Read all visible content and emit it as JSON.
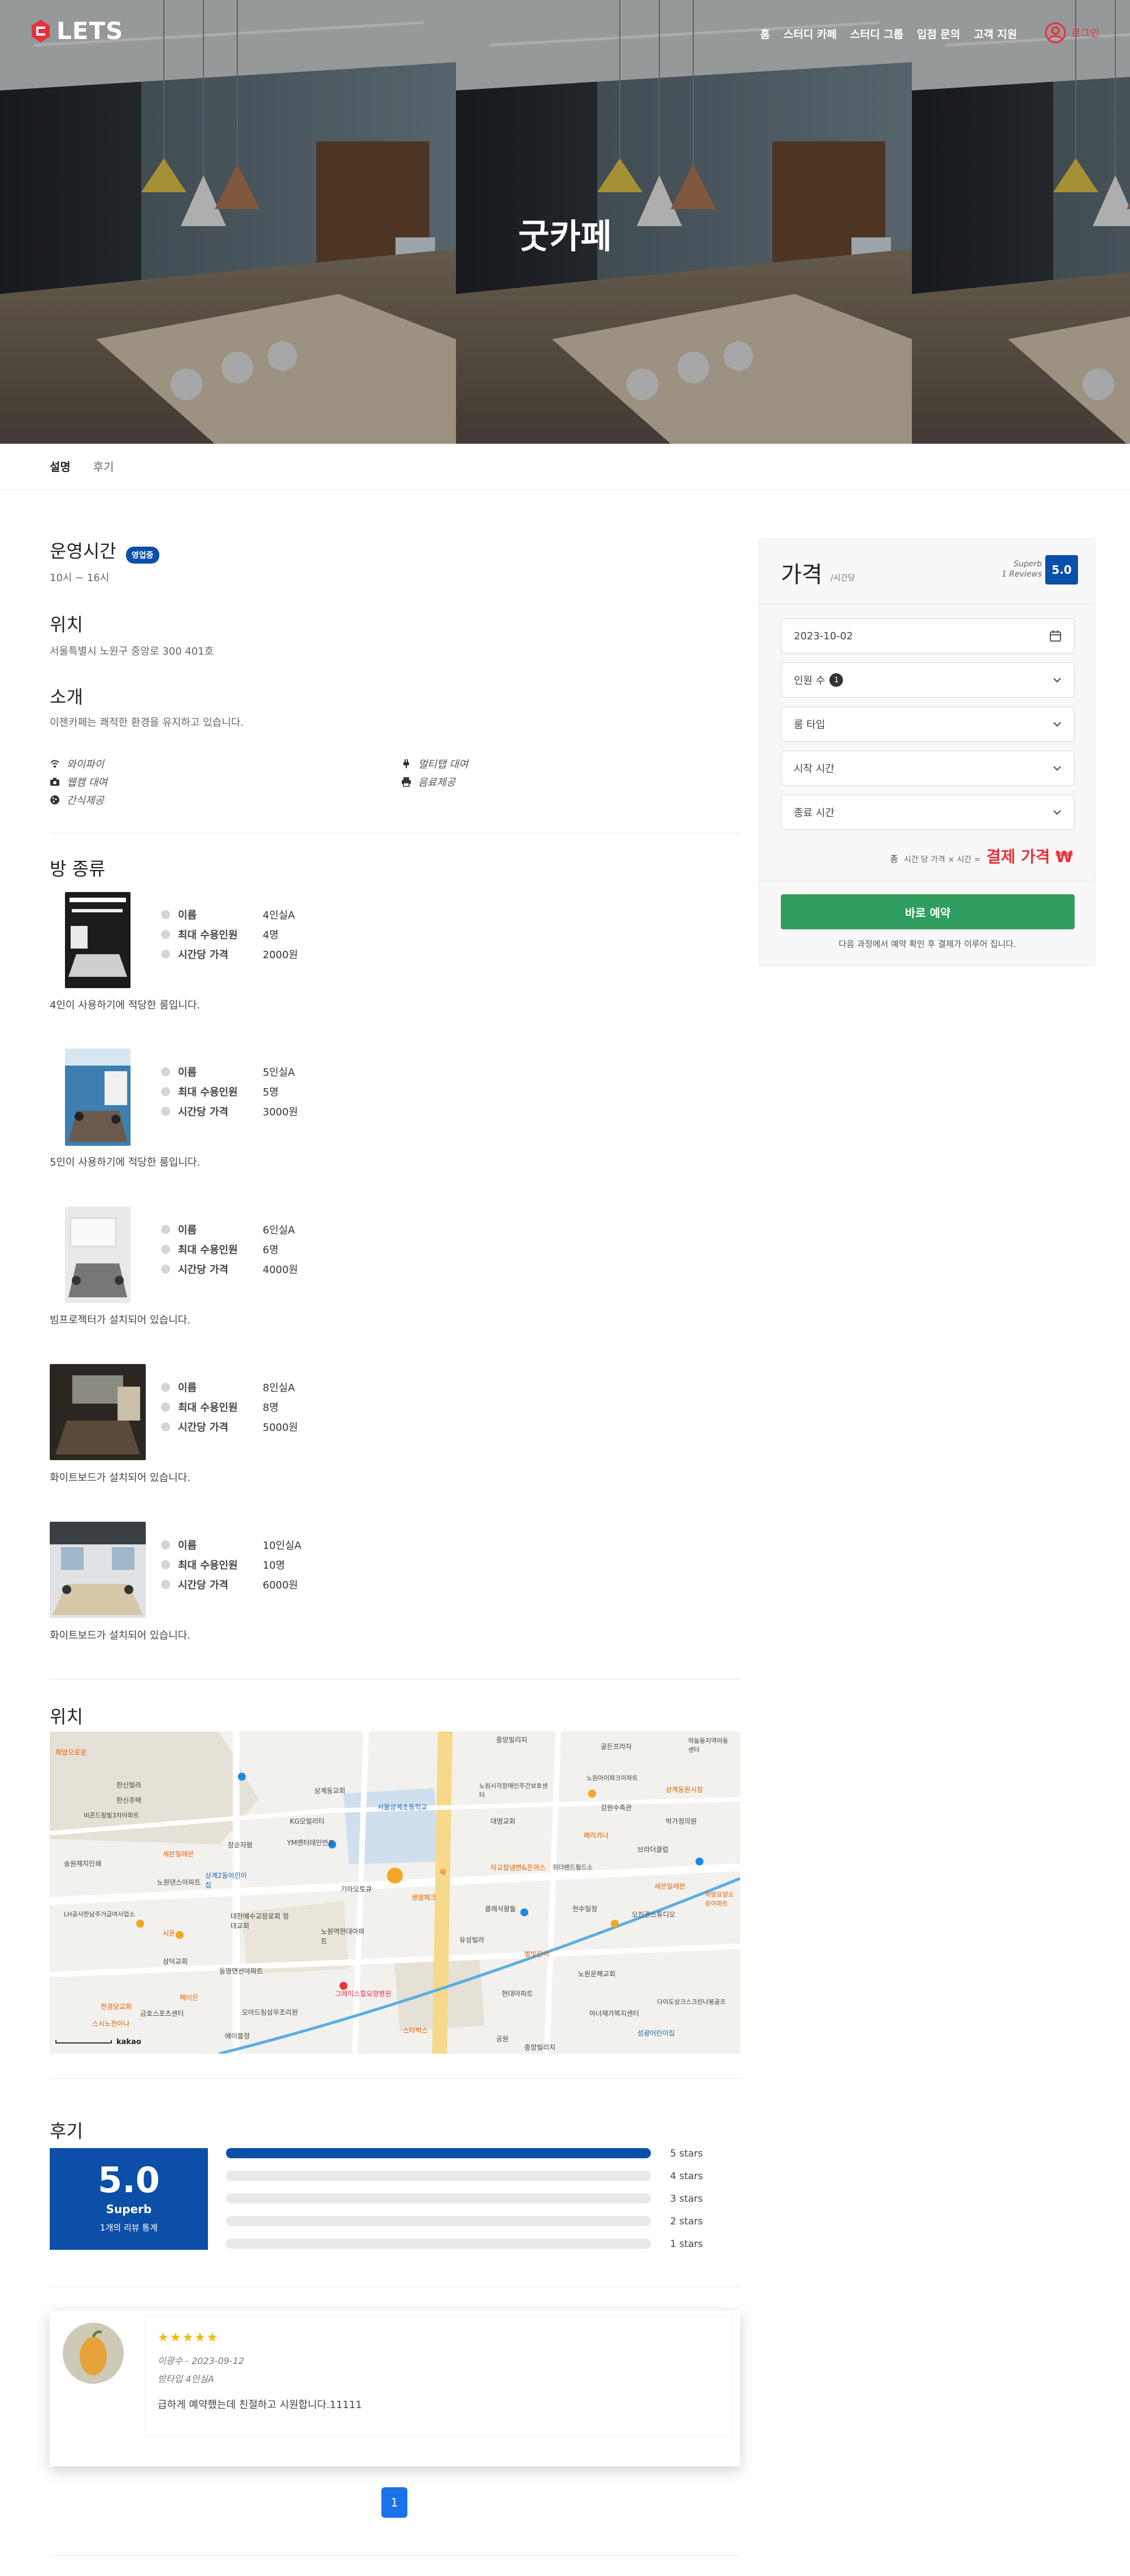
{
  "header": {
    "logo": "LETS",
    "menu": [
      "홈",
      "스터디 카페",
      "스터디 그룹",
      "입점 문의",
      "고객 지원"
    ],
    "login": "로그인"
  },
  "hero": {
    "title": "굿카페"
  },
  "tabs": [
    "설명",
    "후기"
  ],
  "info": {
    "hours_title": "운영시간",
    "hours_badge": "영업중",
    "hours": "10시 ~ 16시",
    "location_title": "위치",
    "address": "서울특별시 노원구 중앙로 300 401호",
    "intro_title": "소개",
    "intro": "이젠카페는 쾌적한 환경을 유지하고 있습니다.",
    "amenities": [
      {
        "icon": "wifi-icon",
        "label": "와이파이"
      },
      {
        "icon": "plug-icon",
        "label": "멀티탭 대여"
      },
      {
        "icon": "camera-icon",
        "label": "웹캠 대여"
      },
      {
        "icon": "printer-icon",
        "label": "음료제공"
      },
      {
        "icon": "cookie-icon",
        "label": "간식제공"
      }
    ]
  },
  "rooms": {
    "title": "방 종류",
    "labels": {
      "name": "이름",
      "capacity": "최대 수용인원",
      "price": "시간당 가격"
    },
    "items": [
      {
        "name": "4인실A",
        "capacity": "4명",
        "price": "2000원",
        "desc": "4인이 사용하기에 적당한 룸입니다."
      },
      {
        "name": "5인실A",
        "capacity": "5명",
        "price": "3000원",
        "desc": "5인이 사용하기에 적당한 룸입니다."
      },
      {
        "name": "6인실A",
        "capacity": "6명",
        "price": "4000원",
        "desc": "빔프로젝터가 설치되어 있습니다."
      },
      {
        "name": "8인실A",
        "capacity": "8명",
        "price": "5000원",
        "desc": "화이트보드가 설치되어 있습니다."
      },
      {
        "name": "10인실A",
        "capacity": "10명",
        "price": "6000원",
        "desc": "화이트보드가 설치되어 있습니다."
      }
    ]
  },
  "map": {
    "title": "위치",
    "logo": "kakao",
    "labels": [
      "중앙빌리지",
      "골든프라자",
      "하늘동지역아동센터",
      "한신빌라",
      "노원시각장애인주간보호센터",
      "노원아이파크아파트",
      "상계동원시장",
      "한신주택",
      "상계동교회",
      "서울상계초등학교",
      "강원수족관",
      "박가정의원",
      "비콘드림빌3차아파트",
      "KG모빌리티",
      "대명교회",
      "페리카나",
      "브라더클럽",
      "송원제지인쇄",
      "세븐일레븐",
      "장순자팜",
      "YM엔터테인먼트",
      "상계2동어린이집",
      "자교칼냉면&돈까스",
      "위더랜드필드소",
      "세븐일레븐",
      "희망요양소원아파트",
      "노원댄스아파트",
      "기아오토큐",
      "쉐",
      "생명체크",
      "클래식왕돌",
      "천수일정",
      "오진관스튜디오",
      "LH공사한남주거급여사업소",
      "대한예수교장로회 정대교회",
      "시온",
      "노원역현대아파트",
      "유성빌라",
      "별빛장어",
      "노원운해교회",
      "삼덕교회",
      "동명맨션아파트",
      "헤이든",
      "그레이스힐요양병원",
      "현대아파트",
      "다이도상크스크린나봉골프",
      "천경당교회",
      "스시노천아나",
      "금호스포츠센터",
      "모아드림삼우조리원",
      "아너재가복지센터",
      "성광어린이집",
      "에이블정",
      "스타벅스",
      "공원",
      "희망으로운",
      "중앙빌리지"
    ]
  },
  "reviews_section": {
    "title": "후기",
    "score": "5.0",
    "grade": "Superb",
    "count": "1개의 리뷰 통계",
    "bars": [
      {
        "label": "5 stars",
        "value": 1.0
      },
      {
        "label": "4 stars",
        "value": 0.0
      },
      {
        "label": "3 stars",
        "value": 0.0
      },
      {
        "label": "2 stars",
        "value": 0.0
      },
      {
        "label": "1 stars",
        "value": 0.0
      }
    ],
    "review": {
      "stars": "★★★★★",
      "rating": 5,
      "meta": "이광수 - 2023-09-12",
      "room": "방타입 4인실A",
      "text": "급하게 예약했는데 친절하고 시원합니다.11111"
    },
    "page": "1"
  },
  "booking": {
    "title": "가격",
    "unit": "/시간당",
    "grade": "Superb",
    "reviews": "1 Reviews",
    "score": "5.0",
    "date": "2023-10-02",
    "people": "인원 수",
    "people_count": "1",
    "room_type": "룸 타입",
    "start": "시작 시간",
    "end": "종료 시간",
    "total_label": "총",
    "formula": "시간 당 가격 × 시간 =",
    "total": "결제 가격 ₩",
    "button": "바로 예약",
    "note": "다음 과정에서 예약 확인 후 결제가 이루어 집니다."
  },
  "colors": {
    "brand": "#e8303a",
    "blue": "#0b4fa8",
    "green": "#2f9e5e",
    "star": "#f5b800"
  }
}
